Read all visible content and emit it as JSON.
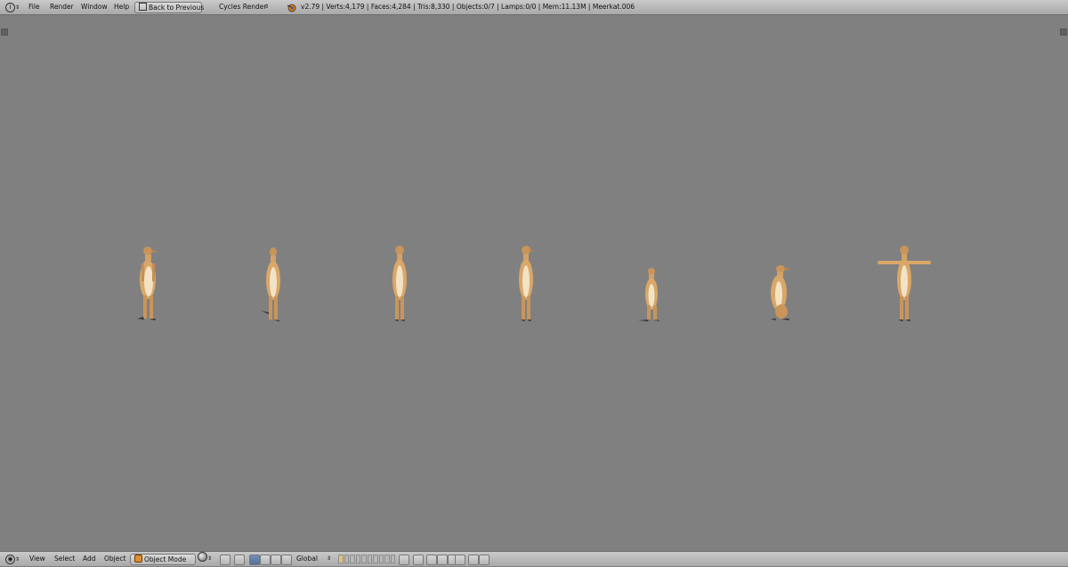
{
  "topbar": {
    "menus": [
      "File",
      "Render",
      "Window",
      "Help"
    ],
    "back_button": "Back to Previous",
    "render_engine": "Cycles Render",
    "stats": "v2.79 | Verts:4,179 | Faces:4,284 | Tris:8,330 | Objects:0/7 | Lamps:0/0 | Mem:11.13M | Meerkat.006"
  },
  "bottombar": {
    "menus": [
      "View",
      "Select",
      "Add",
      "Object"
    ],
    "mode": "Object Mode",
    "orientation": "Global"
  },
  "icons": {
    "info": "info-icon",
    "blender": "blender-logo-icon",
    "viewport_shading": "viewport-shading-icon"
  },
  "colors": {
    "viewport_bg": "#808080",
    "header_bg": "#b4b4b4",
    "meerkat_fur": "#d9a767",
    "meerkat_belly": "#f2e2c6"
  }
}
